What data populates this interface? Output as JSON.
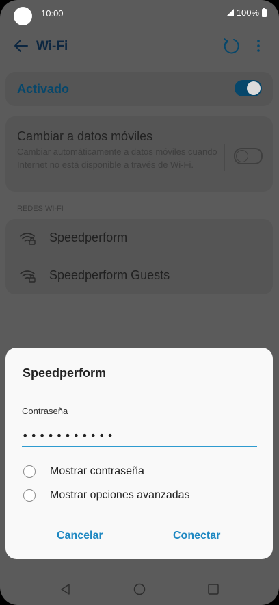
{
  "status_bar": {
    "time": "10:00",
    "battery": "100%"
  },
  "app_bar": {
    "title": "Wi-Fi"
  },
  "wifi_toggle": {
    "label": "Activado",
    "on": true
  },
  "mobile_data_switch": {
    "title": "Cambiar a datos móviles",
    "description": "Cambiar automáticamente a datos móviles cuando Internet no está disponible a través de Wi-Fi.",
    "on": false
  },
  "networks_section": {
    "label": "REDES WI-FI",
    "networks": [
      {
        "name": "Speedperform",
        "icon": "wifi-lock-icon"
      },
      {
        "name": "Speedperform Guests",
        "icon": "wifi-lock-icon"
      }
    ]
  },
  "dialog": {
    "title": "Speedperform",
    "password_label": "Contraseña",
    "password_value": "•••••••••••",
    "options": [
      {
        "label": "Mostrar contraseña",
        "checked": false
      },
      {
        "label": "Mostrar opciones avanzadas",
        "checked": false
      }
    ],
    "cancel_label": "Cancelar",
    "connect_label": "Conectar"
  },
  "colors": {
    "accent": "#1e88c2",
    "toggle_on": "#06476b"
  }
}
